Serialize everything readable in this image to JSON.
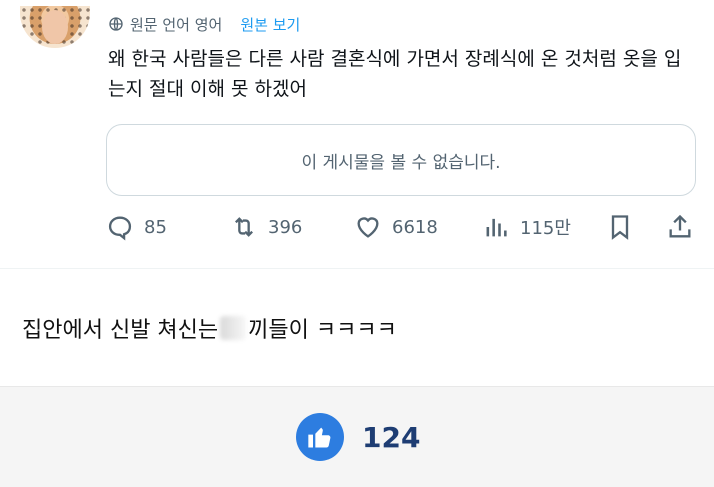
{
  "tweet": {
    "translate_label": "원문 언어 영어",
    "show_original": "원본 보기",
    "text": "왜 한국 사람들은 다른 사람 결혼식에 가면서 장례식에 온 것처럼 옷을 입는지 절대 이해 못 하겠어",
    "unavailable": "이 게시물을 볼 수 없습니다.",
    "stats": {
      "replies": "85",
      "retweets": "396",
      "likes": "6618",
      "views": "115만"
    }
  },
  "comment": {
    "text_before": "집안에서 신발 쳐신는",
    "text_after": "끼들이 ㅋㅋㅋㅋ"
  },
  "footer": {
    "like_count": "124"
  },
  "colors": {
    "accent": "#1d9bf0",
    "muted": "#536471",
    "like_button": "#2d7de0",
    "like_count": "#1e3d73"
  },
  "icons": [
    "globe-icon",
    "reply-icon",
    "retweet-icon",
    "heart-icon",
    "views-icon",
    "bookmark-icon",
    "share-icon",
    "thumbs-up-icon"
  ]
}
